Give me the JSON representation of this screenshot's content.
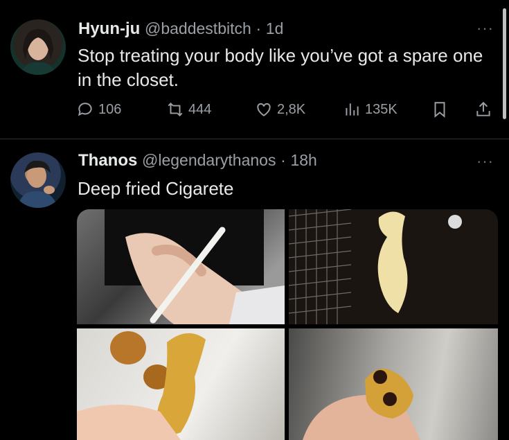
{
  "tweets": [
    {
      "name": "Hyun-ju",
      "handle": "@baddestbitch",
      "separator": "·",
      "time": "1d",
      "text": "Stop treating your body like you’ve got a spare one in the closet.",
      "more": "···",
      "stats": {
        "replies": "106",
        "reposts": "444",
        "likes": "2,8K",
        "views": "135K"
      }
    },
    {
      "name": "Thanos",
      "handle": "@legendarythanos",
      "separator": "·",
      "time": "18h",
      "text": "Deep fried Cigarete",
      "more": "···"
    }
  ],
  "icons": [
    "reply-icon",
    "repost-icon",
    "like-icon",
    "views-icon",
    "bookmark-icon",
    "share-icon",
    "more-icon"
  ],
  "colors": {
    "background": "#000000",
    "text": "#e7e9ea",
    "muted": "#9aa0a6",
    "divider": "#2f3336"
  }
}
